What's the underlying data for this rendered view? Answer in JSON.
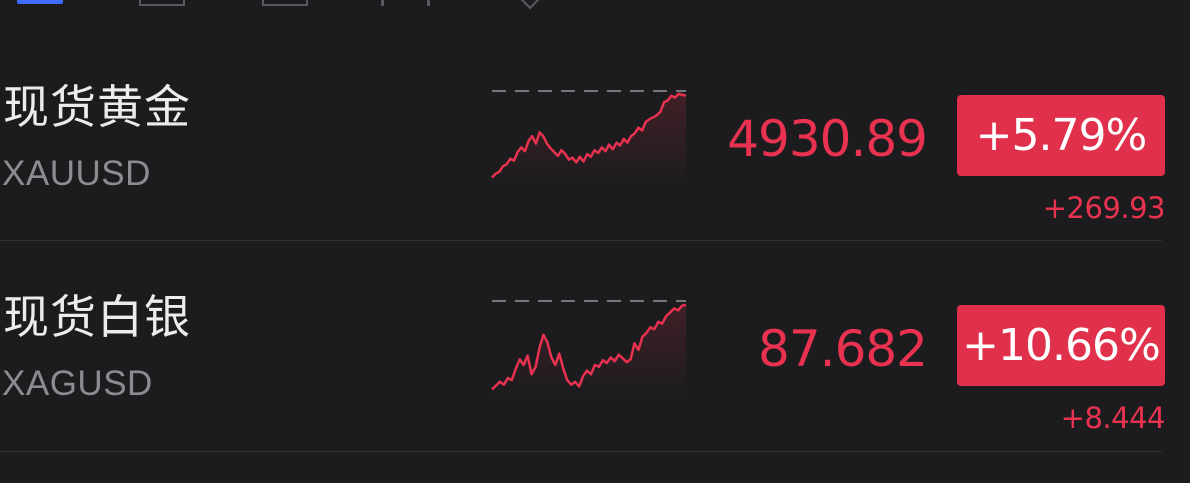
{
  "colors": {
    "background": "#1c1c1e",
    "up": "#e8324f",
    "badge": "#e1304c",
    "tab_indicator": "#3d6cff"
  },
  "tabs": [
    "selected-tab-icon",
    "tab-icon-2",
    "tab-icon-3",
    "tab-icon-4",
    "tab-icon-5"
  ],
  "quotes": [
    {
      "name": "现货黄金",
      "symbol": "XAUUSD",
      "price": "4930.89",
      "change_pct": "+5.79%",
      "change": "+269.93",
      "sparkline": [
        8,
        12,
        14,
        20,
        22,
        28,
        26,
        35,
        40,
        36,
        47,
        52,
        44,
        56,
        52,
        44,
        39,
        35,
        31,
        37,
        33,
        27,
        29,
        24,
        30,
        25,
        33,
        30,
        37,
        34,
        40,
        36,
        43,
        38,
        45,
        42,
        49,
        45,
        52,
        55,
        61,
        58,
        67,
        70,
        72,
        74,
        78,
        88,
        90,
        95,
        93,
        97,
        96,
        95
      ]
    },
    {
      "name": "现货白银",
      "symbol": "XAGUSD",
      "price": "87.682",
      "change_pct": "+10.66%",
      "change": "+8.444",
      "sparkline": [
        6,
        10,
        14,
        11,
        18,
        16,
        28,
        38,
        32,
        42,
        22,
        30,
        50,
        64,
        56,
        40,
        32,
        44,
        28,
        16,
        11,
        14,
        9,
        20,
        26,
        22,
        32,
        30,
        37,
        34,
        40,
        36,
        43,
        39,
        35,
        38,
        55,
        48,
        62,
        66,
        72,
        70,
        78,
        76,
        84,
        88,
        92,
        90,
        95,
        96
      ]
    }
  ]
}
